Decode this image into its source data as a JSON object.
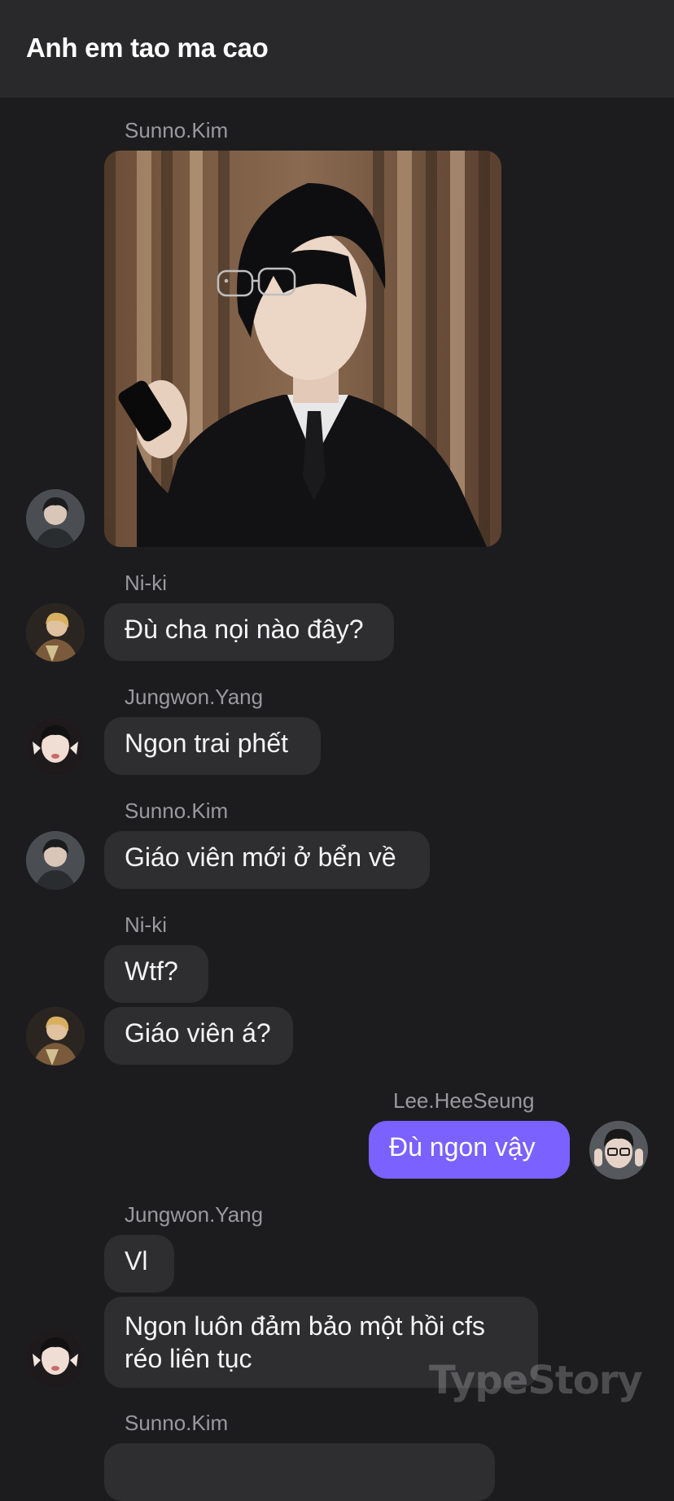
{
  "header": {
    "title": "Anh em tao ma cao"
  },
  "messages": {
    "m1_sender": "Sunno.Kim",
    "m2_sender": "Ni-ki",
    "m2_text": "Đù cha nọi nào đây?",
    "m3_sender": "Jungwon.Yang",
    "m3_text": "Ngon trai phết",
    "m4_sender": "Sunno.Kim",
    "m4_text": "Giáo viên mới ở bển về",
    "m5_sender": "Ni-ki",
    "m5_text1": "Wtf?",
    "m5_text2": "Giáo viên á?",
    "m6_sender": "Lee.HeeSeung",
    "m6_text": "Đù ngon vậy",
    "m7_sender": "Jungwon.Yang",
    "m7_text1": "Vl",
    "m7_text2": "Ngon luôn đảm bảo một hồi cfs réo liên tục",
    "m8_sender": "Sunno.Kim"
  },
  "watermark": "TypeStory",
  "colors": {
    "background": "#1c1c1e",
    "header": "#29292b",
    "bubble_other": "#2e2e31",
    "bubble_mine": "#7b61ff",
    "sender_text": "#9a9a9e"
  }
}
